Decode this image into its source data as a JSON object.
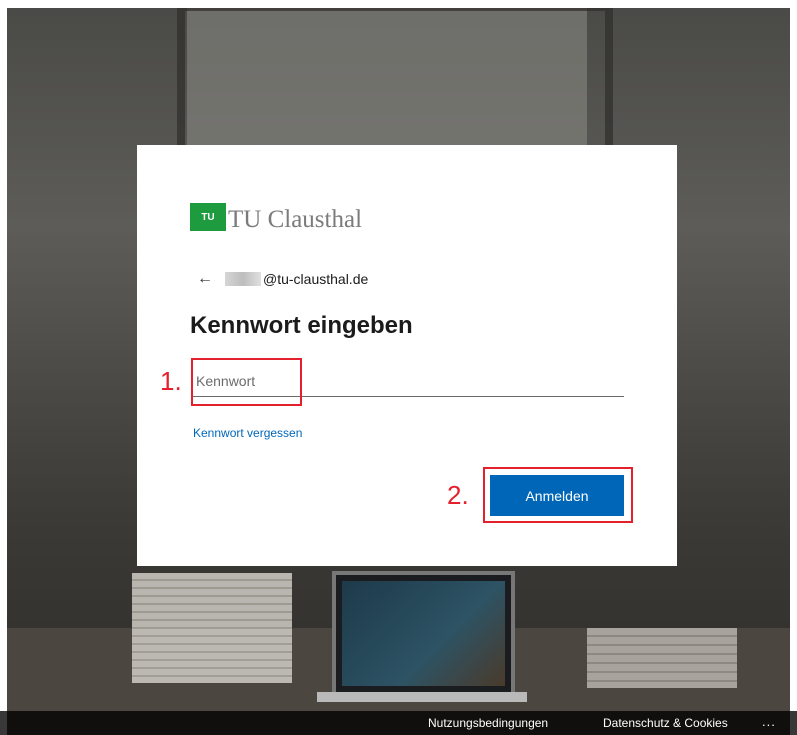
{
  "logo": {
    "mark_text": "TU",
    "name": "TU Clausthal"
  },
  "account": {
    "back_icon": "arrow-left-icon",
    "email_suffix": "@tu-clausthal.de"
  },
  "heading": "Kennwort eingeben",
  "password": {
    "placeholder": "Kennwort",
    "value": ""
  },
  "forgot_link": "Kennwort vergessen",
  "signin_button": "Anmelden",
  "annotations": {
    "step1": "1.",
    "step2": "2."
  },
  "footer": {
    "terms": "Nutzungsbedingungen",
    "privacy": "Datenschutz & Cookies",
    "more": "..."
  },
  "colors": {
    "accent": "#0067b8",
    "logo_green": "#1e9a3f",
    "annotation_red": "#e3202b"
  }
}
